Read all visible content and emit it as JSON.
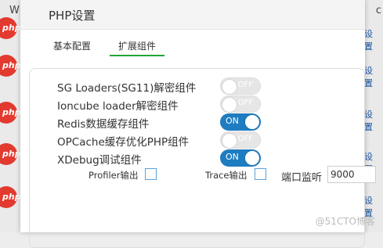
{
  "background": {
    "left_partial_text": "W",
    "right_partial_text": "c",
    "right_link": "设置",
    "icon_label": "php"
  },
  "dialog": {
    "title": "PHP设置",
    "tabs": [
      "基本配置",
      "扩展组件"
    ],
    "active_tab": "扩展组件"
  },
  "extensions": [
    {
      "label": "SG Loaders(SG11)解密组件",
      "state": "OFF"
    },
    {
      "label": "Ioncube loader解密组件",
      "state": "OFF"
    },
    {
      "label": "Redis数据缓存组件",
      "state": "ON"
    },
    {
      "label": "OPCache缓存优化PHP组件",
      "state": "OFF"
    },
    {
      "label": "XDebug调试组件",
      "state": "ON"
    }
  ],
  "xdebug_options": {
    "profiler_label": "Profiler输出",
    "trace_label": "Trace输出",
    "port_label": "端口监听",
    "port_value": "9000"
  },
  "colors": {
    "switch_on": "#1e7cc0",
    "switch_off": "#e6e6e6",
    "active_tab": "#20a53a"
  },
  "watermark": "@51CTO博客"
}
